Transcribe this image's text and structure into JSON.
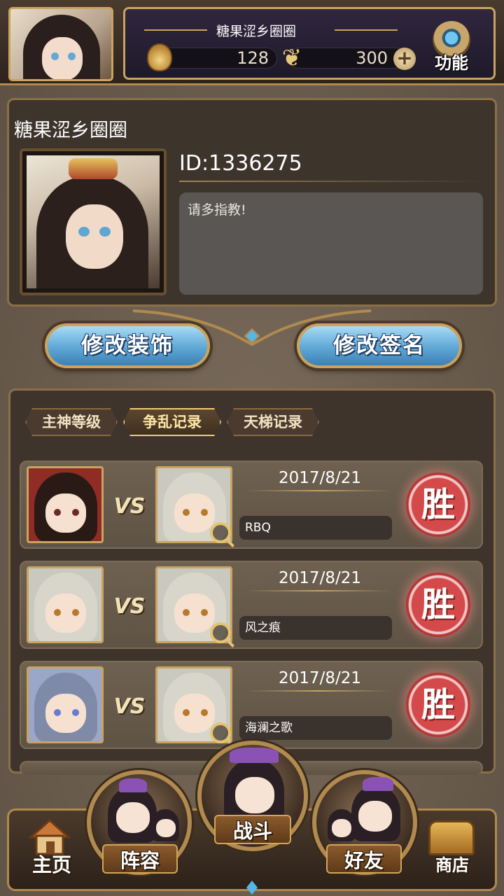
{
  "header": {
    "player_name": "糖果涩乡圈圈",
    "currency_primary": "128",
    "currency_secondary": "300",
    "function_label": "功能",
    "icons": [
      "flame-spirit-icon",
      "butterfly-icon",
      "plus-icon",
      "gear-icon"
    ]
  },
  "profile": {
    "name": "糖果涩乡圈圈",
    "id_text": "ID:1336275",
    "signature": "请多指教!"
  },
  "actions": {
    "edit_decoration": "修改装饰",
    "edit_signature": "修改签名"
  },
  "tabs": [
    {
      "label": "主神等级",
      "active": false
    },
    {
      "label": "争乱记录",
      "active": true
    },
    {
      "label": "天梯记录",
      "active": false
    }
  ],
  "records": [
    {
      "vs": "VS",
      "date": "2017/8/21",
      "opponent": "RBQ",
      "result": "胜"
    },
    {
      "vs": "VS",
      "date": "2017/8/21",
      "opponent": "风之痕",
      "result": "胜"
    },
    {
      "vs": "VS",
      "date": "2017/8/21",
      "opponent": "海澜之歌",
      "result": "胜"
    }
  ],
  "nav": {
    "home": "主页",
    "lineup": "阵容",
    "battle": "战斗",
    "friends": "好友",
    "shop": "商店"
  },
  "colors": {
    "gold_border": "#c9a35f",
    "button_blue": "#5fa7d6",
    "win_red": "#d44a4a",
    "panel_dark": "#3e342c"
  }
}
